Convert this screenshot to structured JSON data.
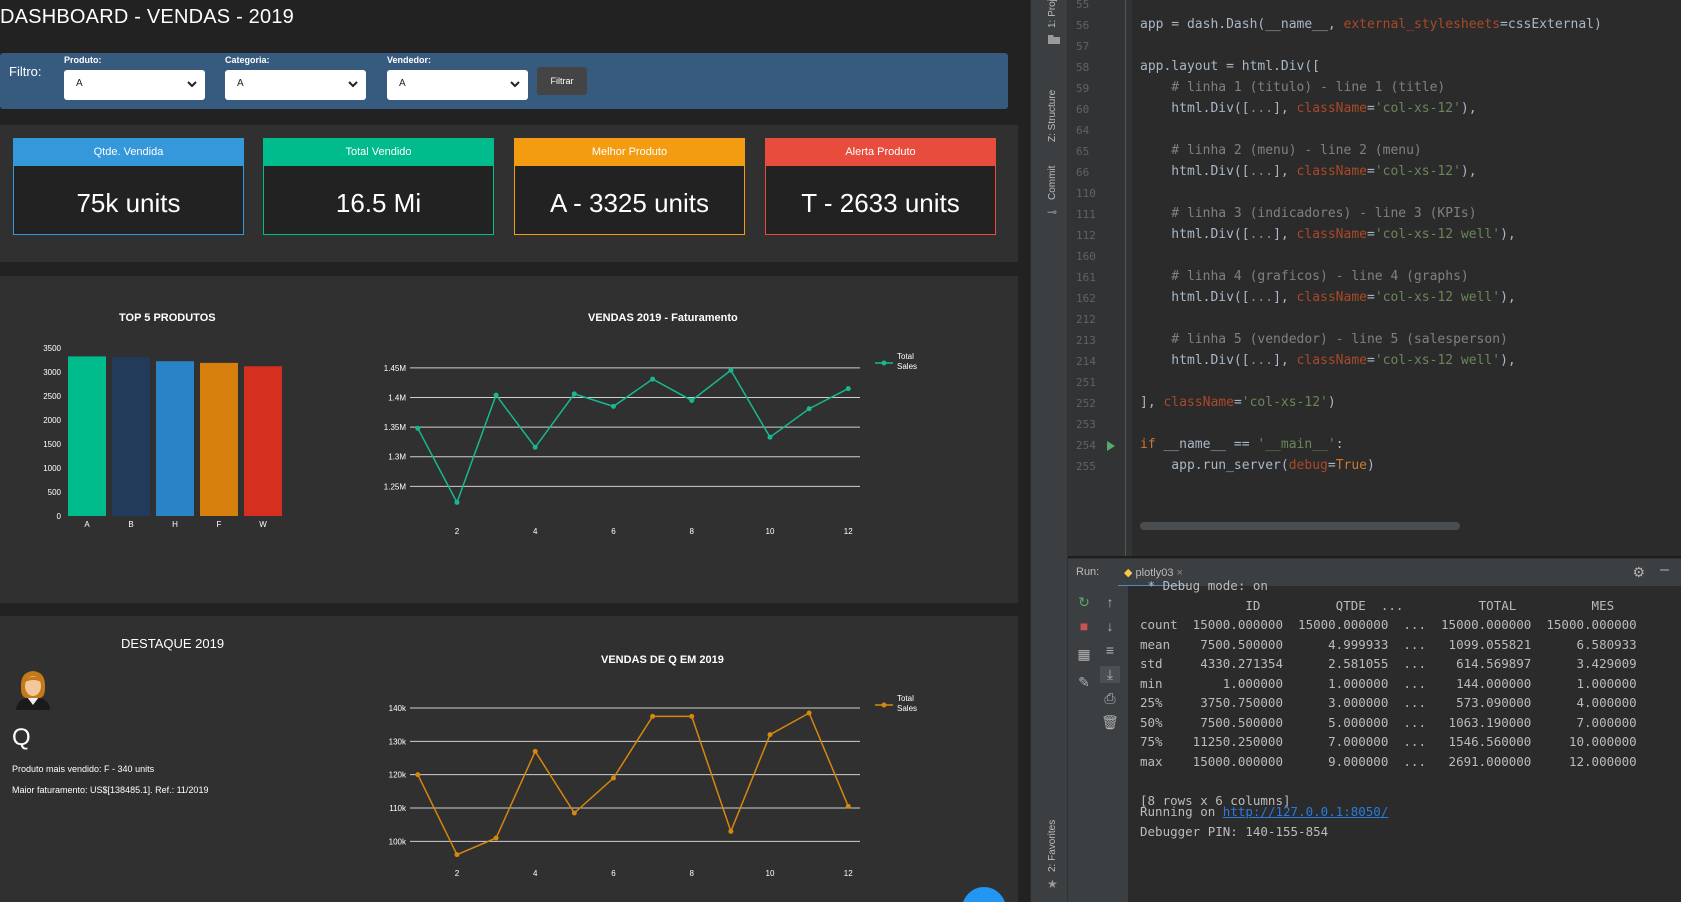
{
  "dashboard": {
    "title": "DASHBOARD - VENDAS - 2019",
    "filter": {
      "label": "Filtro:",
      "fields": [
        {
          "label": "Produto:",
          "value": "A"
        },
        {
          "label": "Categoria:",
          "value": "A"
        },
        {
          "label": "Vendedor:",
          "value": "A"
        }
      ],
      "button": "Filtrar"
    },
    "kpis": [
      {
        "label": "Qtde. Vendida",
        "value": "75k units",
        "color": "#3498db"
      },
      {
        "label": "Total Vendido",
        "value": "16.5 Mi",
        "color": "#00bc8c"
      },
      {
        "label": "Melhor Produto",
        "value": "A - 3325 units",
        "color": "#f39c12"
      },
      {
        "label": "Alerta Produto",
        "value": "T - 2633 units",
        "color": "#e74c3c"
      }
    ],
    "destaque": {
      "title": "DESTAQUE 2019",
      "name": "Q",
      "line1": "Produto mais vendido: F - 340 units",
      "line2": "Maior faturamento: US$[138485.1]. Ref.: 11/2019"
    }
  },
  "chart_data": [
    {
      "type": "bar",
      "title": "TOP 5 PRODUTOS",
      "categories": [
        "A",
        "B",
        "H",
        "F",
        "W"
      ],
      "values": [
        3325,
        3310,
        3225,
        3190,
        3120
      ],
      "colors": [
        "#00bc8c",
        "#233b5a",
        "#2a83c6",
        "#d67f0d",
        "#d5301f"
      ],
      "ylim": [
        0,
        3500
      ],
      "yticks": [
        0,
        500,
        1000,
        1500,
        2000,
        2500,
        3000,
        3500
      ]
    },
    {
      "type": "line",
      "title": "VENDAS 2019 - Faturamento",
      "series": [
        {
          "name": "Total Sales",
          "color": "#17b890",
          "x": [
            1,
            2,
            3,
            4,
            5,
            6,
            7,
            8,
            9,
            10,
            11,
            12
          ],
          "values": [
            1348000,
            1223000,
            1404000,
            1316000,
            1406000,
            1385000,
            1431000,
            1395000,
            1446000,
            1333000,
            1381000,
            1415000
          ]
        }
      ],
      "ylim": [
        1200000,
        1470000
      ],
      "yticks": [
        1250000,
        1300000,
        1350000,
        1400000,
        1450000
      ],
      "ytick_labels": [
        "1.25M",
        "1.3M",
        "1.35M",
        "1.4M",
        "1.45M"
      ],
      "xticks": [
        2,
        4,
        6,
        8,
        10,
        12
      ],
      "xlim": [
        0.8,
        12.3
      ]
    },
    {
      "type": "line",
      "title": "VENDAS DE Q EM 2019",
      "series": [
        {
          "name": "Total Sales",
          "color": "#d6870e",
          "x": [
            1,
            2,
            3,
            4,
            5,
            6,
            7,
            8,
            9,
            10,
            11,
            12
          ],
          "values": [
            120000,
            96000,
            101000,
            127000,
            108500,
            119000,
            137500,
            137500,
            103000,
            132000,
            138500,
            110500
          ]
        }
      ],
      "ylim": [
        95000,
        143000
      ],
      "yticks": [
        100000,
        110000,
        120000,
        130000,
        140000
      ],
      "ytick_labels": [
        "100k",
        "110k",
        "120k",
        "130k",
        "140k"
      ],
      "xticks": [
        2,
        4,
        6,
        8,
        10,
        12
      ],
      "xlim": [
        0.8,
        12.3
      ]
    }
  ],
  "ide": {
    "side_tabs": [
      "1: Proj",
      "Z: Structure",
      "Commit",
      "2: Favorites"
    ],
    "line_numbers": [
      "55",
      "56",
      "57",
      "58",
      "59",
      "60",
      "64",
      "65",
      "66",
      "110",
      "111",
      "112",
      "160",
      "161",
      "162",
      "212",
      "213",
      "214",
      "251",
      "252",
      "253",
      "254",
      "255"
    ],
    "code": {
      "l56": {
        "a": "app = dash.Dash(__name__, ",
        "b": "external_stylesheets",
        "c": "=cssExternal)"
      },
      "l58": "app.layout = html.Div([",
      "l59": "    # linha 1 (titulo) - line 1 (title)",
      "l60": {
        "a": "    html.Div([",
        "b": "...",
        "c": "], ",
        "d": "className",
        "e": "=",
        "f": "'col-xs-12'",
        "g": "),"
      },
      "l65": "    # linha 2 (menu) - line 2 (menu)",
      "l66": {
        "a": "    html.Div([",
        "b": "...",
        "c": "], ",
        "d": "className",
        "e": "=",
        "f": "'col-xs-12'",
        "g": "),"
      },
      "l111": "    # linha 3 (indicadores) - line 3 (KPIs)",
      "l112": {
        "a": "    html.Div([",
        "b": "...",
        "c": "], ",
        "d": "className",
        "e": "=",
        "f": "'col-xs-12 well'",
        "g": "),"
      },
      "l161": "    # linha 4 (graficos) - line 4 (graphs)",
      "l162": {
        "a": "    html.Div([",
        "b": "...",
        "c": "], ",
        "d": "className",
        "e": "=",
        "f": "'col-xs-12 well'",
        "g": "),"
      },
      "l213": "    # linha 5 (vendedor) - line 5 (salesperson)",
      "l214": {
        "a": "    html.Div([",
        "b": "...",
        "c": "], ",
        "d": "className",
        "e": "=",
        "f": "'col-xs-12 well'",
        "g": "),"
      },
      "l252": {
        "a": "], ",
        "b": "className",
        "c": "=",
        "d": "'col-xs-12'",
        "e": ")"
      },
      "l254": {
        "a": "if",
        "b": " __name__ == ",
        "c": "'__main__'",
        "d": ":"
      },
      "l255": {
        "a": "    app.run_server(",
        "b": "debug",
        "c": "=",
        "d": "True",
        "e": ")"
      }
    },
    "run": {
      "label": "Run:",
      "tab": "plotly03",
      "console": [
        " * Debug mode: on",
        "              ID          QTDE  ...          TOTAL          MES",
        "count  15000.000000  15000.000000  ...  15000.000000  15000.000000",
        "mean    7500.500000      4.999933  ...   1099.055821      6.580933",
        "std     4330.271354      2.581055  ...    614.569897      3.429009",
        "min        1.000000      1.000000  ...    144.000000      1.000000",
        "25%     3750.750000      3.000000  ...    573.090000      4.000000",
        "50%     7500.500000      5.000000  ...   1063.190000      7.000000",
        "75%    11250.250000      7.000000  ...   1546.560000     10.000000",
        "max    15000.000000      9.000000  ...   2691.000000     12.000000",
        "",
        "[8 rows x 6 columns]"
      ],
      "running_prefix": "Running on ",
      "running_url": "http://127.0.0.1:8050/",
      "debugger_pin": "Debugger PIN: 140-155-854"
    }
  }
}
